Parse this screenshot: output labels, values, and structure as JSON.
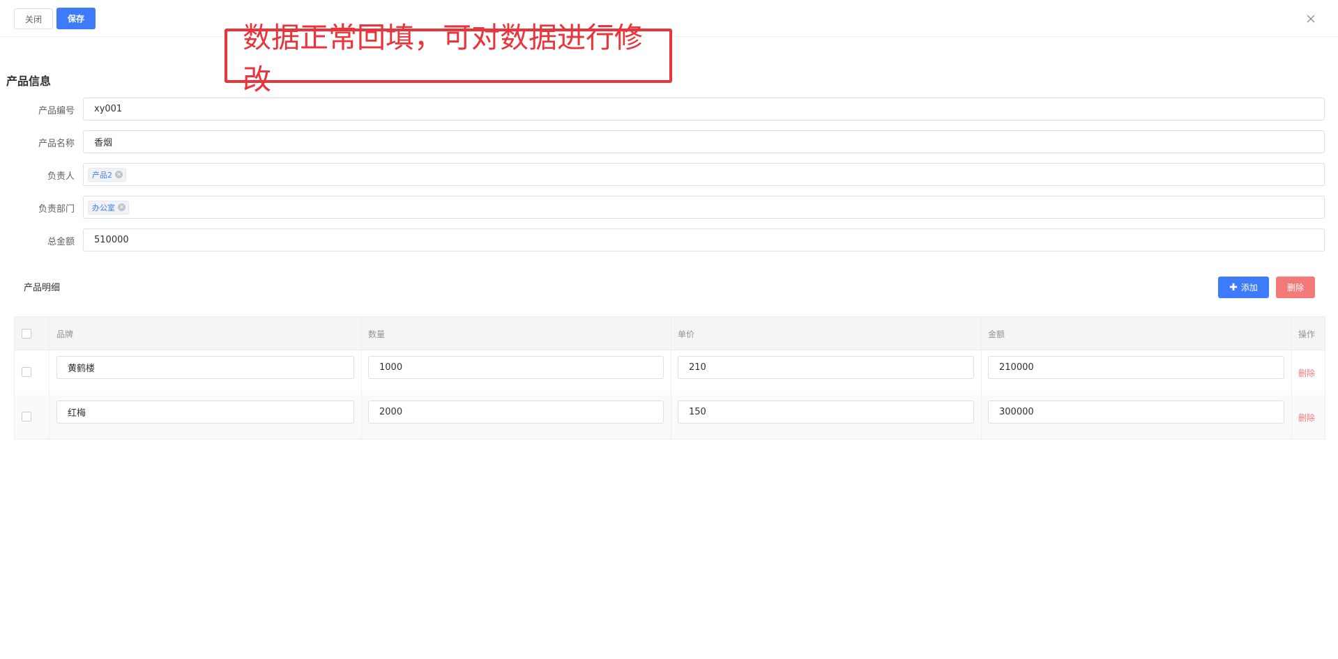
{
  "toolbar": {
    "close_label": "关闭",
    "save_label": "保存"
  },
  "annotation": {
    "text": "数据正常回填，可对数据进行修改"
  },
  "product_info": {
    "title": "产品信息",
    "fields": [
      {
        "label": "产品编号",
        "value": "xy001"
      },
      {
        "label": "产品名称",
        "value": "香烟"
      },
      {
        "label": "负责人",
        "tag": "产品2"
      },
      {
        "label": "负责部门",
        "tag": "办公室"
      },
      {
        "label": "总金额",
        "value": "510000"
      }
    ]
  },
  "details": {
    "title": "产品明细",
    "add_label": "添加",
    "delete_label": "删除",
    "columns": [
      "品牌",
      "数量",
      "单价",
      "金额",
      "操作"
    ],
    "rows": [
      {
        "brand": "黄鹤楼",
        "qty": "1000",
        "price": "210",
        "amount": "210000",
        "action": "删除"
      },
      {
        "brand": "红梅",
        "qty": "2000",
        "price": "150",
        "amount": "300000",
        "action": "删除"
      }
    ]
  },
  "colors": {
    "primary": "#3e7bfa",
    "danger": "#f47a7a",
    "annotation": "#e8343a"
  }
}
